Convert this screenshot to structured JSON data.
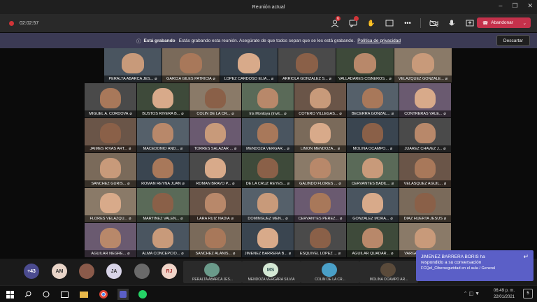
{
  "window": {
    "title": "Reunión actual"
  },
  "toolbar": {
    "timer": "02:02:57",
    "chat_badge": "6",
    "leave_label": "Abandonar"
  },
  "banner": {
    "strong": "Está grabando",
    "text": "Estás grabando esta reunión. Asegúrate de que todos sepan que se les está grabando.",
    "link": "Política de privacidad",
    "dismiss": "Descartar"
  },
  "participants": [
    "PERALTA ABARCA JES...",
    "GARCIA GILES PATRICIA",
    "LOPEZ CARDOSO ELIA...",
    "ARRIOLA GONZALEZ S...",
    "VALLADARES CISNEROS...",
    "VELAZQUEZ GONZALE...",
    "MIGUEL A. CORDOVA",
    "BUSTOS RIVERA B...",
    "COLIN DE LA CR...",
    "Iris Montoya (Invit...",
    "COTERO VILLEGAS...",
    "BECERRA GONZAL...",
    "CONTRERAS VALE...",
    "JAIMES RIVAS ART...",
    "MACEDONIO AND...",
    "TORRES SALAZAR ...",
    "MENDOZA VERGAR...",
    "LIMON MENDOZA...",
    "MOLINA OCAMPO...",
    "JUAREZ CHAVEZ J...",
    "SANCHEZ GURIS...",
    "ROMAN REYNA JUAN",
    "ROMAN BRAVO P...",
    "DE LA CRUZ REYES...",
    "GALINDO FLORES ...",
    "CERVANTES BADIL...",
    "VELASQUEZ AGUIL...",
    "FLORES VELAZQU...",
    "MARTINEZ VALEN...",
    "LARA RUIZ NADIA",
    "DOMINGUEZ MEN...",
    "CERVANTES PEREZ...",
    "GONZALEZ MORA...",
    "DIAZ HUERTA JESUS",
    "AGUILAR NEGRE...",
    "ALMA CONCEPCIO...",
    "SANCHEZ ALANIS...",
    "JIMENEZ BARRERA B...",
    "ESQUIVEL LOPEZ ...",
    "AGUILAR QUADAR...",
    "VARGAS PINILLA D..."
  ],
  "tray": {
    "overflow": "+43",
    "initials": [
      "AM",
      "JA",
      "RJ",
      "MS"
    ],
    "names": [
      "PERALTA ABARCA JES...",
      "MENDOZA VERGARA SILVIA",
      "COLIN DE LA CR...",
      "MOLINA OCAMPO AR..."
    ]
  },
  "toast": {
    "line1": "JIMENEZ BARRERA BORIS ha",
    "line2": "respondido a su conversación",
    "line3": "FCQeI_Ciberseguridad en el aula / General"
  },
  "taskbar": {
    "time": "06:49 p. m.",
    "date": "22/01/2021",
    "notif": "5"
  }
}
